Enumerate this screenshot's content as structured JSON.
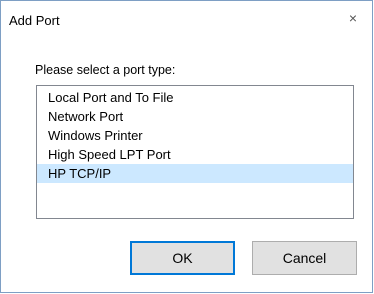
{
  "dialog": {
    "title": "Add Port",
    "close_glyph": "×",
    "prompt": "Please select a port type:",
    "port_types": [
      {
        "label": "Local Port and To File",
        "selected": false
      },
      {
        "label": "Network Port",
        "selected": false
      },
      {
        "label": "Windows Printer",
        "selected": false
      },
      {
        "label": "High Speed LPT Port",
        "selected": false
      },
      {
        "label": "HP TCP/IP",
        "selected": true
      }
    ],
    "ok_label": "OK",
    "cancel_label": "Cancel"
  },
  "colors": {
    "selection": "#cce8ff",
    "default_button_border": "#0078d7",
    "window_border": "#7e9fc4"
  }
}
